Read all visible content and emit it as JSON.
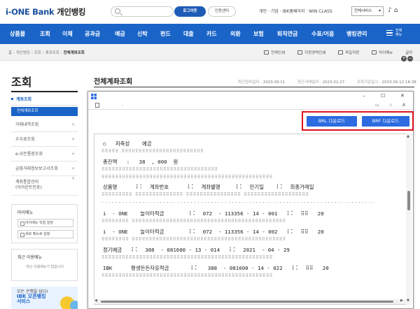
{
  "header": {
    "logo_main": "i-ONE Bank",
    "logo_sub": "개인뱅킹",
    "logout_label": "로그아웃",
    "cert_label": "인증센터",
    "topnav": "개인 · 기업 · IBK홈페이지 · WIN CLASS",
    "service_select": "전체서비스"
  },
  "nav": {
    "items": [
      "상품몰",
      "조회",
      "이체",
      "공과금",
      "예금",
      "신탁",
      "펀드",
      "대출",
      "카드",
      "외환",
      "보험",
      "퇴직연금",
      "수표/어음",
      "뱅킹관리"
    ],
    "all_menu": "전체 메뉴"
  },
  "breadcrumb": {
    "path": "홈 › 개인뱅킹 › 조회 › 계좌조회 › ",
    "current": "전체계좌조회",
    "tools": [
      "전체인쇄",
      "지정영역인쇄",
      "파일저장",
      "마이메뉴",
      "글자"
    ]
  },
  "sidebar": {
    "title": "조회",
    "group_open": "계좌조회",
    "active_sub": "전체계좌조회",
    "items": [
      "거래내역조회",
      "수수료조회",
      "e-모든통장조회",
      "금융거래정보보고서조회"
    ],
    "item_two_line": [
      "계좌통합관리",
      "(어카운트인포)"
    ]
  },
  "mymenu": {
    "title": "마이메뉴",
    "btn1": "마이메뉴 직접 설정",
    "btn2": "새로 메뉴로 설정"
  },
  "recent": {
    "title": "최근 이용메뉴",
    "msg": "최근 이용메뉴가 없습니다."
  },
  "promo": {
    "line1": "모든 은행을 담다!",
    "line2": "IBK 오픈뱅킹",
    "line3": "서비스"
  },
  "main": {
    "title": "전체계좌조회",
    "meta": [
      {
        "k": "최근접속일자 :",
        "v": "2023.09.11"
      },
      {
        "k": "최근거래일자 :",
        "v": "2023.02.27"
      },
      {
        "k": "조회기준일시 :",
        "v": "2023.09.12 18:38"
      }
    ]
  },
  "popup": {
    "btn_brl": "BRL 다운로드",
    "btn_brf": "BRF 다운로드",
    "lines": [
      "○   저축성    예금",
      "총잔액   :   38  , 000  원",
      "상품명      ⠇⠅  계좌번호      ⠇⠅  계좌별명     ⠇⠅  만기일    ⠇⠅  최종거래일",
      "i  - ONE    놀이터적금        ⠇⠅  072  - 113356 - 14 - 001   ⠇⠅  ⠿⠿   20",
      "i  - ONE    놀이터적금        ⠇⠅  072  - 113356 - 14 - 002   ⠇⠅  ⠿⠿   20",
      "정기예금   ⠇⠅  388  - 081600 - 13 - 014   ⠇⠅  2021  - 04 - 29",
      "IBK      평생든든자유적금       ⠇⠅   388  - 081600 - 14 - 022   ⠇⠅  ⠿⠿   20"
    ]
  }
}
